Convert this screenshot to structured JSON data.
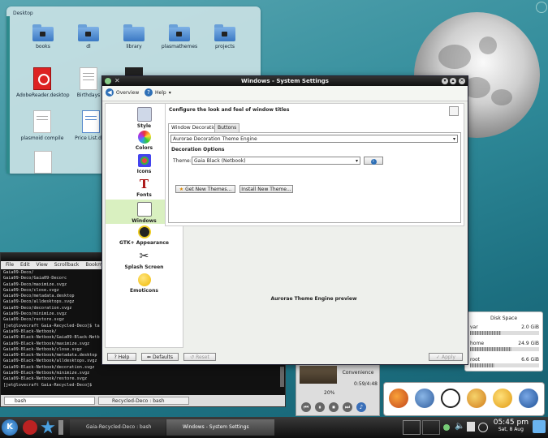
{
  "desktop": {
    "folderview_title": "Desktop",
    "icons": [
      {
        "label": "books"
      },
      {
        "label": "dl"
      },
      {
        "label": "library"
      },
      {
        "label": "plasmathemes"
      },
      {
        "label": "projects"
      },
      {
        "label": "AdobeReader.desktop"
      },
      {
        "label": "Birthdays"
      },
      {
        "label": "plasmoid compile"
      },
      {
        "label": "Price List.doc"
      }
    ]
  },
  "window": {
    "title": "Windows - System Settings",
    "toolbar": {
      "overview": "Overview",
      "help": "Help"
    },
    "sidebar": [
      {
        "label": "Style"
      },
      {
        "label": "Colors"
      },
      {
        "label": "Icons"
      },
      {
        "label": "Fonts"
      },
      {
        "label": "Windows",
        "selected": true
      },
      {
        "label": "GTK+ Appearance"
      },
      {
        "label": "Splash Screen"
      },
      {
        "label": "Emoticons"
      }
    ],
    "heading": "Configure the look and feel of window titles",
    "tabs": [
      "Window Decoration",
      "Buttons"
    ],
    "engine_select": "Aurorae Decoration Theme Engine",
    "decoration_options": "Decoration Options",
    "theme_label": "Theme:",
    "theme_value": "Gaia Black (Netbook)",
    "get_new_themes": "Get New Themes...",
    "install_new_theme": "Install New Theme...",
    "preview_text": "Aurorae Theme Engine preview",
    "bottom": {
      "help": "Help",
      "defaults": "Defaults",
      "reset": "Reset",
      "apply": "Apply"
    }
  },
  "terminal": {
    "title": "Gaia-Recycled-Deco : bash",
    "menu": [
      "File",
      "Edit",
      "View",
      "Scrollback",
      "Bookmarks"
    ],
    "lines": [
      "Gaia09-Deco/",
      "Gaia09-Deco/Gaia09-Decorc",
      "Gaia09-Deco/maximize.svgz",
      "Gaia09-Deco/close.svgz",
      "Gaia09-Deco/metadata.desktop",
      "Gaia09-Deco/alldesktops.svgz",
      "Gaia09-Deco/decoration.svgz",
      "Gaia09-Deco/minimize.svgz",
      "Gaia09-Deco/restore.svgz",
      "[jet@lovecraft Gaia-Recycled-Deco]$ ta",
      "Gaia09-Black-Netbook/",
      "Gaia09-Black-Netbook/Gaia09-Black-Netb",
      "Gaia09-Black-Netbook/maximize.svgz",
      "Gaia09-Black-Netbook/close.svgz",
      "Gaia09-Black-Netbook/metadata.desktop",
      "Gaia09-Black-Netbook/alldesktops.svgz",
      "Gaia09-Black-Netbook/decoration.svgz",
      "Gaia09-Black-Netbook/minimize.svgz",
      "Gaia09-Black-Netbook/restore.svgz",
      "[jet@lovecraft Gaia-Recycled-Deco]$ "
    ],
    "tabs": [
      "bash",
      "Recycled-Deco : bash"
    ]
  },
  "disk": {
    "title": "Disk Space",
    "rows": [
      {
        "name": "var",
        "value": "2.0 GiB",
        "fill": 0.45
      },
      {
        "name": "home",
        "value": "24.9 GiB",
        "fill": 0.6
      },
      {
        "name": "root",
        "value": "6.6 GiB",
        "fill": 0.35
      }
    ]
  },
  "player": {
    "track": "Convenience",
    "time": "0:59/4:48",
    "volume": "20%"
  },
  "taskbar": {
    "tasks": [
      "Gaia-Recycled-Deco : bash",
      "Windows - System Settings"
    ],
    "time": "05:45 pm",
    "date": "Sat, 8 Aug"
  }
}
